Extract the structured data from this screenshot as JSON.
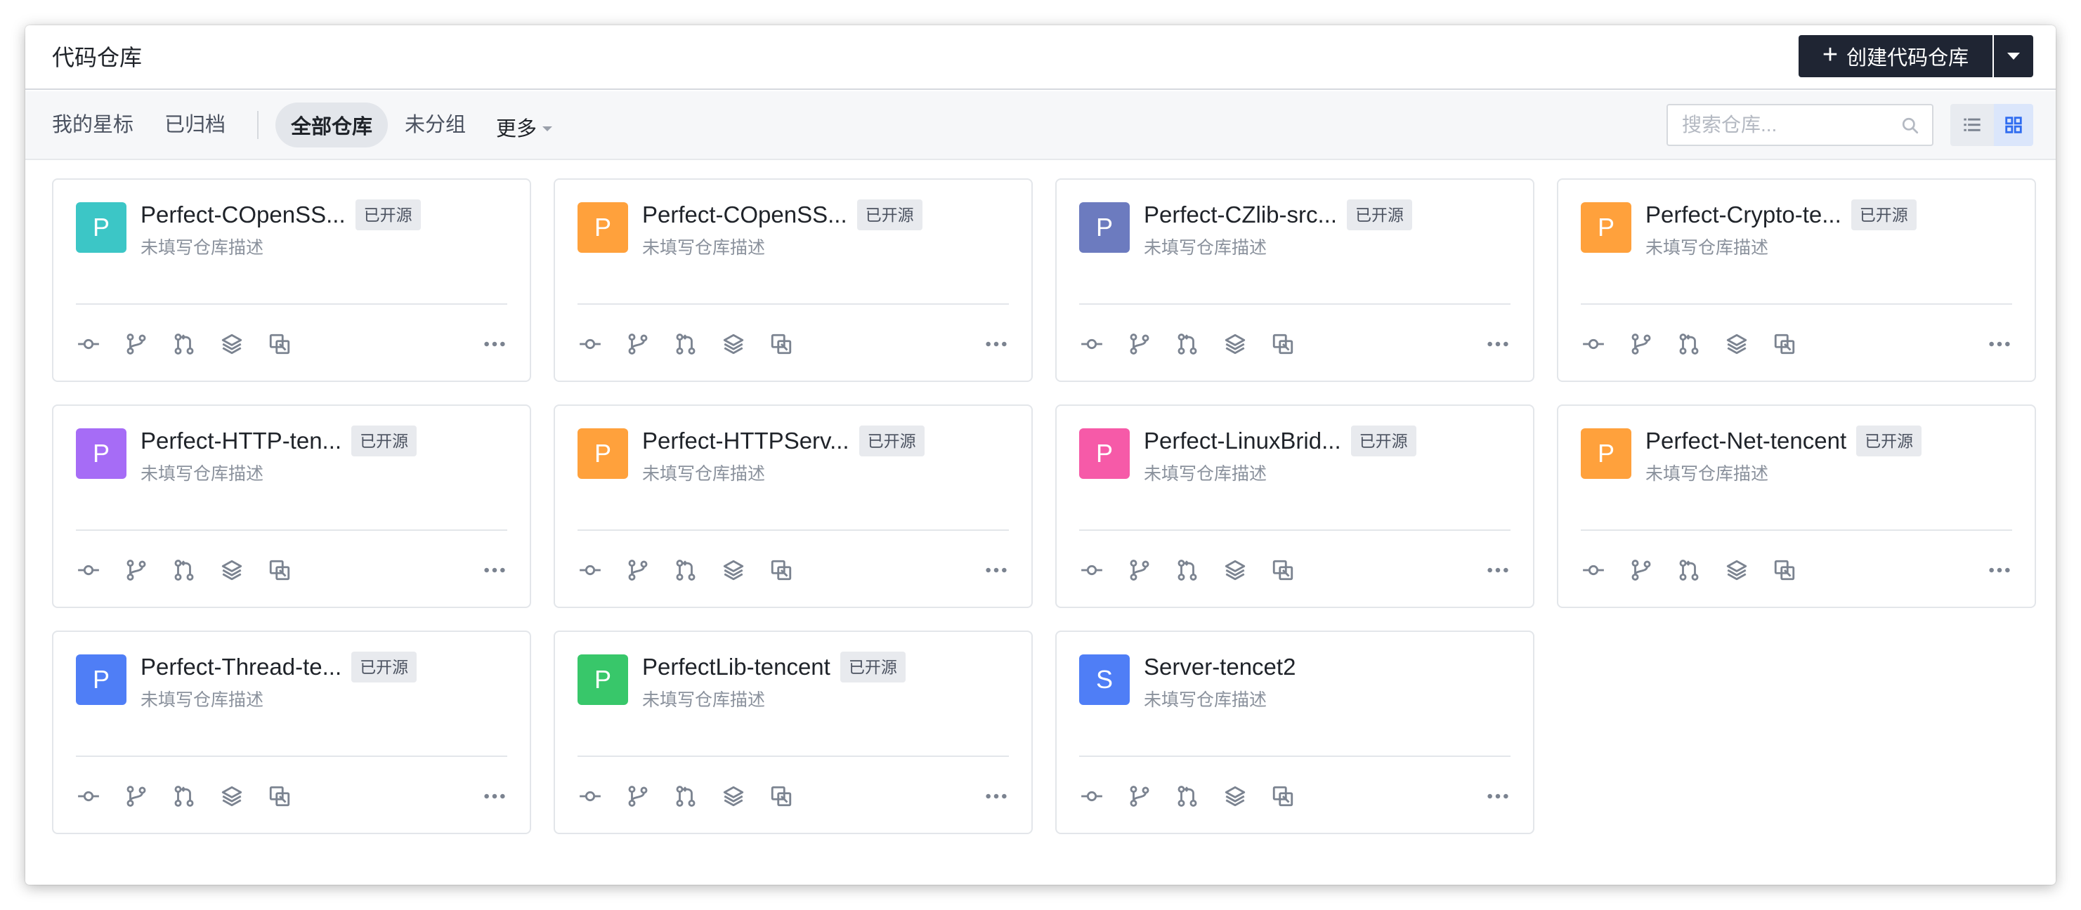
{
  "header": {
    "title": "代码仓库",
    "create_label": "创建代码仓库"
  },
  "toolbar": {
    "starred": "我的星标",
    "archived": "已归档",
    "all_repos": "全部仓库",
    "ungrouped": "未分组",
    "more": "更多",
    "search_placeholder": "搜索仓库..."
  },
  "colors": {
    "teal": "#3cc6c6",
    "orange": "#ffa13c",
    "indigo": "#6c7bbf",
    "purple": "#a66cf6",
    "pink": "#f65aa8",
    "blue": "#4f7ef6",
    "green": "#38c76a",
    "primary_dark": "#1f2533"
  },
  "repos": [
    {
      "initial": "P",
      "name": "Perfect-COpenSS...",
      "badge": "已开源",
      "desc": "未填写仓库描述",
      "color": "#3cc6c6"
    },
    {
      "initial": "P",
      "name": "Perfect-COpenSS...",
      "badge": "已开源",
      "desc": "未填写仓库描述",
      "color": "#ffa13c"
    },
    {
      "initial": "P",
      "name": "Perfect-CZlib-src...",
      "badge": "已开源",
      "desc": "未填写仓库描述",
      "color": "#6c7bbf"
    },
    {
      "initial": "P",
      "name": "Perfect-Crypto-te...",
      "badge": "已开源",
      "desc": "未填写仓库描述",
      "color": "#ffa13c"
    },
    {
      "initial": "P",
      "name": "Perfect-HTTP-ten...",
      "badge": "已开源",
      "desc": "未填写仓库描述",
      "color": "#a66cf6"
    },
    {
      "initial": "P",
      "name": "Perfect-HTTPServ...",
      "badge": "已开源",
      "desc": "未填写仓库描述",
      "color": "#ffa13c"
    },
    {
      "initial": "P",
      "name": "Perfect-LinuxBrid...",
      "badge": "已开源",
      "desc": "未填写仓库描述",
      "color": "#f65aa8"
    },
    {
      "initial": "P",
      "name": "Perfect-Net-tencent",
      "badge": "已开源",
      "desc": "未填写仓库描述",
      "color": "#ffa13c"
    },
    {
      "initial": "P",
      "name": "Perfect-Thread-te...",
      "badge": "已开源",
      "desc": "未填写仓库描述",
      "color": "#4f7ef6"
    },
    {
      "initial": "P",
      "name": "PerfectLib-tencent",
      "badge": "已开源",
      "desc": "未填写仓库描述",
      "color": "#38c76a"
    },
    {
      "initial": "S",
      "name": "Server-tencet2",
      "badge": "",
      "desc": "未填写仓库描述",
      "color": "#4f7ef6"
    }
  ],
  "card_actions": [
    "commit-icon",
    "branch-icon",
    "merge-request-icon",
    "layers-icon",
    "copy-icon",
    "more-icon"
  ]
}
